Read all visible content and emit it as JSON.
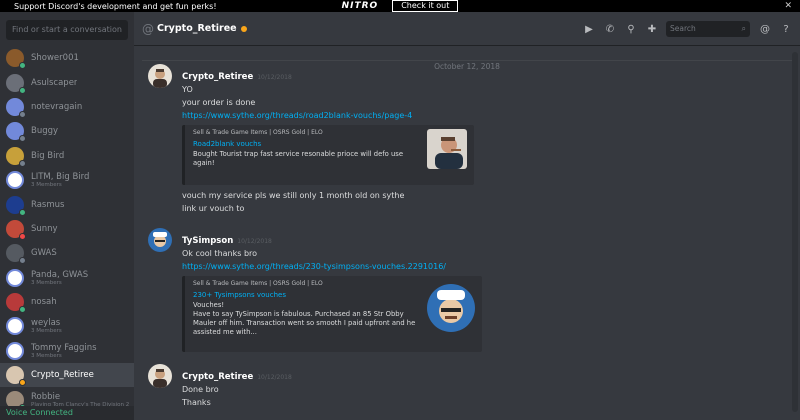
{
  "banner": {
    "logo": "NITRO",
    "message": "Support Discord's development and get fun perks!",
    "cta": "Check it out"
  },
  "sidebar": {
    "find_placeholder": "Find or start a conversation",
    "items": [
      {
        "name": "Shower001",
        "sub": "",
        "color": "#8a5a2b",
        "status": "on"
      },
      {
        "name": "Asulscaper",
        "sub": "",
        "color": "#6b6f78",
        "status": "on"
      },
      {
        "name": "notevragain",
        "sub": "",
        "color": "#7289da",
        "status": "off"
      },
      {
        "name": "Buggy",
        "sub": "",
        "color": "#7289da",
        "status": "off"
      },
      {
        "name": "Big Bird",
        "sub": "",
        "color": "#c7a03a",
        "status": "off"
      },
      {
        "name": "LITM, Big Bird",
        "sub": "3 Members",
        "color": "#ffffff",
        "status": "none"
      },
      {
        "name": "Rasmus",
        "sub": "",
        "color": "#1d3d8f",
        "status": "on"
      },
      {
        "name": "Sunny",
        "sub": "",
        "color": "#c24a3a",
        "status": "dnd"
      },
      {
        "name": "GWAS",
        "sub": "",
        "color": "#555a61",
        "status": "off"
      },
      {
        "name": "Panda, GWAS",
        "sub": "3 Members",
        "color": "#ffffff",
        "status": "none"
      },
      {
        "name": "nosah",
        "sub": "",
        "color": "#b83a3a",
        "status": "on"
      },
      {
        "name": "weylas",
        "sub": "3 Members",
        "color": "#ffffff",
        "status": "none"
      },
      {
        "name": "Tommy Faggins",
        "sub": "3 Members",
        "color": "#ffffff",
        "status": "none"
      },
      {
        "name": "Crypto_Retiree",
        "sub": "",
        "color": "#d8c6b0",
        "status": "idle"
      },
      {
        "name": "Robbie",
        "sub": "Playing Tom Clancy's The Division 2",
        "color": "#9a8a7a",
        "status": "on"
      }
    ],
    "voice_status": "Voice Connected"
  },
  "header": {
    "channel_name": "Crypto_Retiree",
    "search_placeholder": "Search"
  },
  "chat": {
    "date_divider": "October 12, 2018",
    "messages": [
      {
        "author": "Crypto_Retiree",
        "timestamp": "10/12/2018",
        "lines": [
          "YO",
          "your order is done"
        ],
        "link": "https://www.sythe.org/threads/road2blank-vouchs/page-4",
        "embed": {
          "provider": "Sell & Trade Game Items | OSRS Gold | ELO",
          "title": "Road2blank vouchs",
          "description": "Bought Tourist trap fast service resonable prioce will defo use again!"
        },
        "after_lines": [
          "vouch my service pls we still only 1 month old on sythe",
          "link ur vouch to"
        ]
      },
      {
        "author": "TySimpson",
        "timestamp": "10/12/2018",
        "lines": [
          "Ok cool thanks bro"
        ],
        "link": "https://www.sythe.org/threads/230-tysimpsons-vouches.2291016/",
        "embed": {
          "provider": "Sell & Trade Game Items | OSRS Gold | ELO",
          "title": "230+ Tysimpsons vouches",
          "description": "Vouches!\nHave to say TySimpson is fabulous. Purchased an 85 Str Obby Mauler off him. Transaction went so smooth I paid upfront and he assisted me with..."
        }
      },
      {
        "author": "Crypto_Retiree",
        "timestamp": "10/12/2018",
        "lines": [
          "Done bro",
          "Thanks"
        ]
      }
    ]
  },
  "colors": {
    "accent_link": "#00b0f4",
    "online": "#43b581",
    "idle": "#faa61a",
    "dnd": "#f04747"
  }
}
